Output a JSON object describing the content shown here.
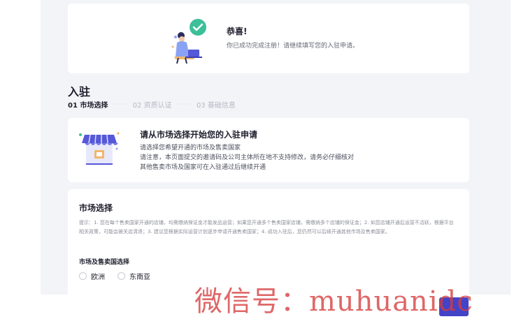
{
  "success": {
    "title": "恭喜!",
    "description": "你已成功完成注册！请继续填写您的入驻申请。"
  },
  "section": {
    "title": "入驻"
  },
  "steps": [
    {
      "label": "01 市场选择",
      "active": true
    },
    {
      "label": "02 资质认证",
      "active": false
    },
    {
      "label": "03 基础信息",
      "active": false
    }
  ],
  "step_separator": "·····",
  "intro": {
    "title": "请从市场选择开始您的入驻申请",
    "lines": [
      "请选择您希望开通的市场及售卖国家",
      "请注意，本页面提交的邀请码及公司主体所在地不支持修改，请务必仔细核对",
      "其他售卖市场及国家可在入驻通过后继续开通"
    ]
  },
  "market_select": {
    "title": "市场选择",
    "tip": "提示：1. 您在每个售卖国家开通的店铺，均需缴纳保证金才能发品运营；如果您开通多个售卖国家店铺，需缴纳多个店铺的保证金；2. 如您店铺开通后运营不活跃，根据平台相关政策，可能会被关店清退；3. 建议您根据实际运营计划逐步申请开通售卖国家；4. 成功入驻后，您仍然可以后续开通其他市场及售卖国家。",
    "subtitle": "市场及售卖国选择",
    "options": [
      "欧洲",
      "东南亚"
    ]
  },
  "watermark": "微信号：muhuanidc",
  "icons": {
    "success": "check-circle-icon",
    "store": "store-icon"
  },
  "colors": {
    "accent": "#4343c8",
    "success_green": "#3dbf9a",
    "background": "#f3f4f8"
  }
}
